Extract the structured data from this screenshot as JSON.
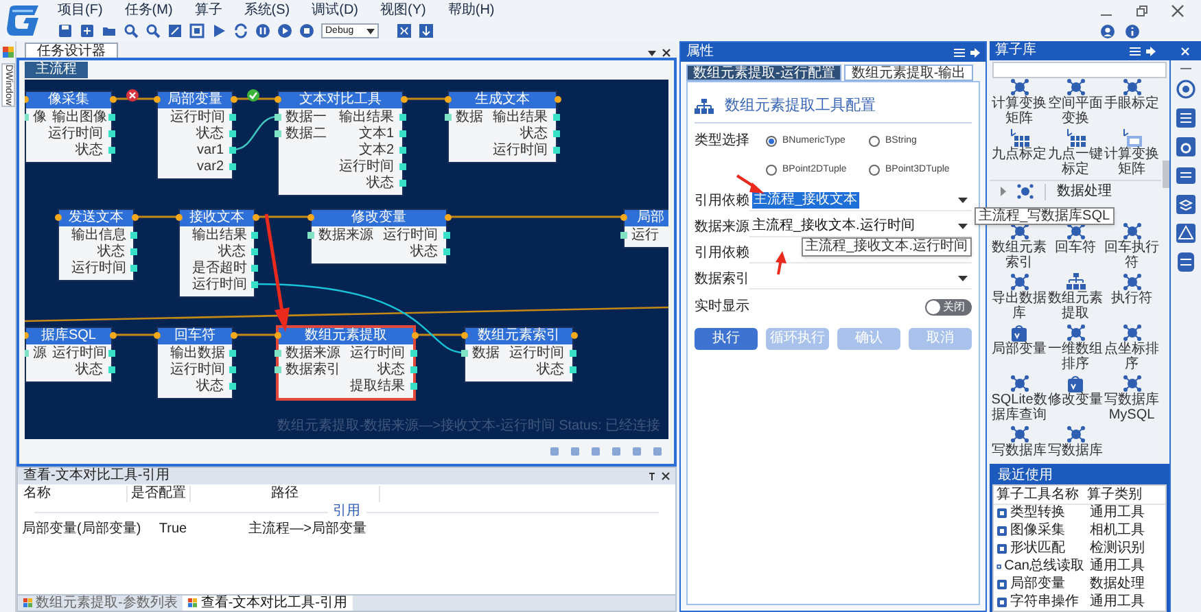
{
  "app": {
    "menu": [
      "项目(F)",
      "任务(M)",
      "算子",
      "系统(S)",
      "调试(D)",
      "视图(Y)",
      "帮助(H)"
    ],
    "mode": "Debug"
  },
  "side_tab": "DWindow",
  "designer": {
    "tab": "任务设计器",
    "subtab": "主流程",
    "status_text": "数组元素提取-数据来源—>接收文本-运行时间 Status: 已经连接",
    "nodes": [
      {
        "title": "像采集",
        "rows": [
          {
            "in": "像",
            "out": "输出图像"
          },
          {
            "out": "运行时间"
          },
          {
            "out": "状态"
          }
        ],
        "selected": false,
        "link_ok": false
      },
      {
        "title": "局部变量",
        "rows": [
          {
            "out": "运行时间"
          },
          {
            "out": "状态"
          },
          {
            "out": "var1"
          },
          {
            "out": "var2"
          }
        ],
        "selected": false,
        "link_ok": true
      },
      {
        "title": "文本对比工具",
        "rows": [
          {
            "in": "数据一",
            "out": "输出结果"
          },
          {
            "in": "数据二",
            "out": "文本1"
          },
          {
            "out": "文本2"
          },
          {
            "out": "运行时间"
          },
          {
            "out": "状态"
          }
        ],
        "selected": false
      },
      {
        "title": "生成文本",
        "rows": [
          {
            "in": "数据",
            "out": "输出结果"
          },
          {
            "out": "状态"
          },
          {
            "out": "运行时间"
          }
        ],
        "selected": false
      },
      {
        "title": "发送文本",
        "rows": [
          {
            "out": "输出信息"
          },
          {
            "out": "状态"
          },
          {
            "out": "运行时间"
          }
        ],
        "selected": false
      },
      {
        "title": "接收文本",
        "rows": [
          {
            "out": "输出结果"
          },
          {
            "out": "状态"
          },
          {
            "out": "是否超时"
          },
          {
            "out": "运行时间"
          }
        ],
        "selected": false
      },
      {
        "title": "修改变量",
        "rows": [
          {
            "in": "数据来源",
            "out": "运行时间"
          },
          {
            "out": "状态"
          }
        ],
        "selected": false
      },
      {
        "title": "局部",
        "rows": [
          {
            "in": "运行"
          }
        ],
        "selected": false
      },
      {
        "title": "据库SQL",
        "rows": [
          {
            "in": "源",
            "out": "运行时间"
          },
          {
            "out": "状态"
          }
        ],
        "selected": false
      },
      {
        "title": "回车符",
        "rows": [
          {
            "out": "输出数据"
          },
          {
            "out": "运行时间"
          },
          {
            "out": "状态"
          }
        ],
        "selected": false
      },
      {
        "title": "数组元素提取",
        "rows": [
          {
            "in": "数据来源",
            "out": "运行时间"
          },
          {
            "in": "数据索引",
            "out": "状态"
          },
          {
            "out": "提取结果"
          }
        ],
        "selected": true
      },
      {
        "title": "数组元素索引",
        "rows": [
          {
            "in": "数据",
            "out": "运行时间"
          },
          {
            "out": "状态"
          }
        ],
        "selected": false
      }
    ]
  },
  "reference_panel": {
    "title": "查看-文本对比工具-引用",
    "columns": [
      "名称",
      "是否配置",
      "路径"
    ],
    "group": "引用",
    "rows": [
      [
        "局部变量(局部变量)",
        "True",
        "主流程—>局部变量"
      ]
    ],
    "tabs": [
      {
        "label": "数组元素提取-参数列表",
        "selected": false
      },
      {
        "label": "查看-文本对比工具-引用",
        "selected": true
      }
    ]
  },
  "properties": {
    "title": "属性",
    "tabs": [
      {
        "label": "数组元素提取-运行配置",
        "selected": true
      },
      {
        "label": "数组元素提取-输出",
        "selected": false
      }
    ],
    "heading": "数组元素提取工具配置",
    "type_label": "类型选择",
    "types": [
      {
        "label": "BNumericType",
        "selected": true
      },
      {
        "label": "BString",
        "selected": false
      },
      {
        "label": "BPoint2DTuple",
        "selected": false
      },
      {
        "label": "BPoint3DTuple",
        "selected": false
      }
    ],
    "fields": [
      {
        "label": "引用依赖",
        "value": "主流程_接收文本",
        "highlighted": true
      },
      {
        "label": "数据来源",
        "value": "主流程_接收文本.运行时间",
        "highlighted": false
      },
      {
        "label": "引用依赖"
      },
      {
        "label": "数据索引"
      }
    ],
    "tooltip": "主流程_接收文本.运行时间",
    "live": {
      "label": "实时显示",
      "on": false,
      "state_text": "关闭"
    },
    "buttons": [
      {
        "label": "执行",
        "disabled": false
      },
      {
        "label": "循环执行",
        "disabled": true
      },
      {
        "label": "确认",
        "disabled": true
      },
      {
        "label": "取消",
        "disabled": true
      }
    ]
  },
  "library": {
    "title": "算子库",
    "tooltip": "主流程_写数据库SQL",
    "items_top": [
      {
        "label": "计算变换矩阵",
        "kind": "network"
      },
      {
        "label": "空间平面变换",
        "kind": "network"
      },
      {
        "label": "手眼标定",
        "kind": "network"
      },
      {
        "label": "九点标定",
        "kind": "grid"
      },
      {
        "label": "九点一键标定",
        "kind": "grid"
      },
      {
        "label": "计算变换矩阵",
        "kind": "matrix"
      }
    ],
    "section": "数据处理",
    "items": [
      {
        "label": "数组元素索引",
        "kind": "network"
      },
      {
        "label": "回车符",
        "kind": "network"
      },
      {
        "label": "回车执行符",
        "kind": "network"
      },
      {
        "label": "导出数据库",
        "kind": "network"
      },
      {
        "label": "数组元素提取",
        "kind": "tree"
      },
      {
        "label": "执行符",
        "kind": "network"
      },
      {
        "label": "局部变量",
        "kind": "var"
      },
      {
        "label": "一维数组排序",
        "kind": "network"
      },
      {
        "label": "点坐标排序",
        "kind": "network"
      },
      {
        "label": "SQLite数据库查询",
        "kind": "network"
      },
      {
        "label": "修改变量",
        "kind": "var"
      },
      {
        "label": "写数据库MySQL",
        "kind": "network"
      },
      {
        "label": "写数据库",
        "kind": "network"
      },
      {
        "label": "写数据库",
        "kind": "network"
      }
    ]
  },
  "recent": {
    "title": "最近使用",
    "columns": [
      "算子工具名称",
      "算子类别"
    ],
    "rows": [
      {
        "name": "类型转换",
        "category": "通用工具"
      },
      {
        "name": "图像采集",
        "category": "相机工具"
      },
      {
        "name": "形状匹配",
        "category": "检测识别"
      },
      {
        "name": "Can总线读取",
        "category": "通用工具"
      },
      {
        "name": "局部变量",
        "category": "数据处理"
      },
      {
        "name": "字符串操作",
        "category": "通用工具"
      }
    ]
  }
}
